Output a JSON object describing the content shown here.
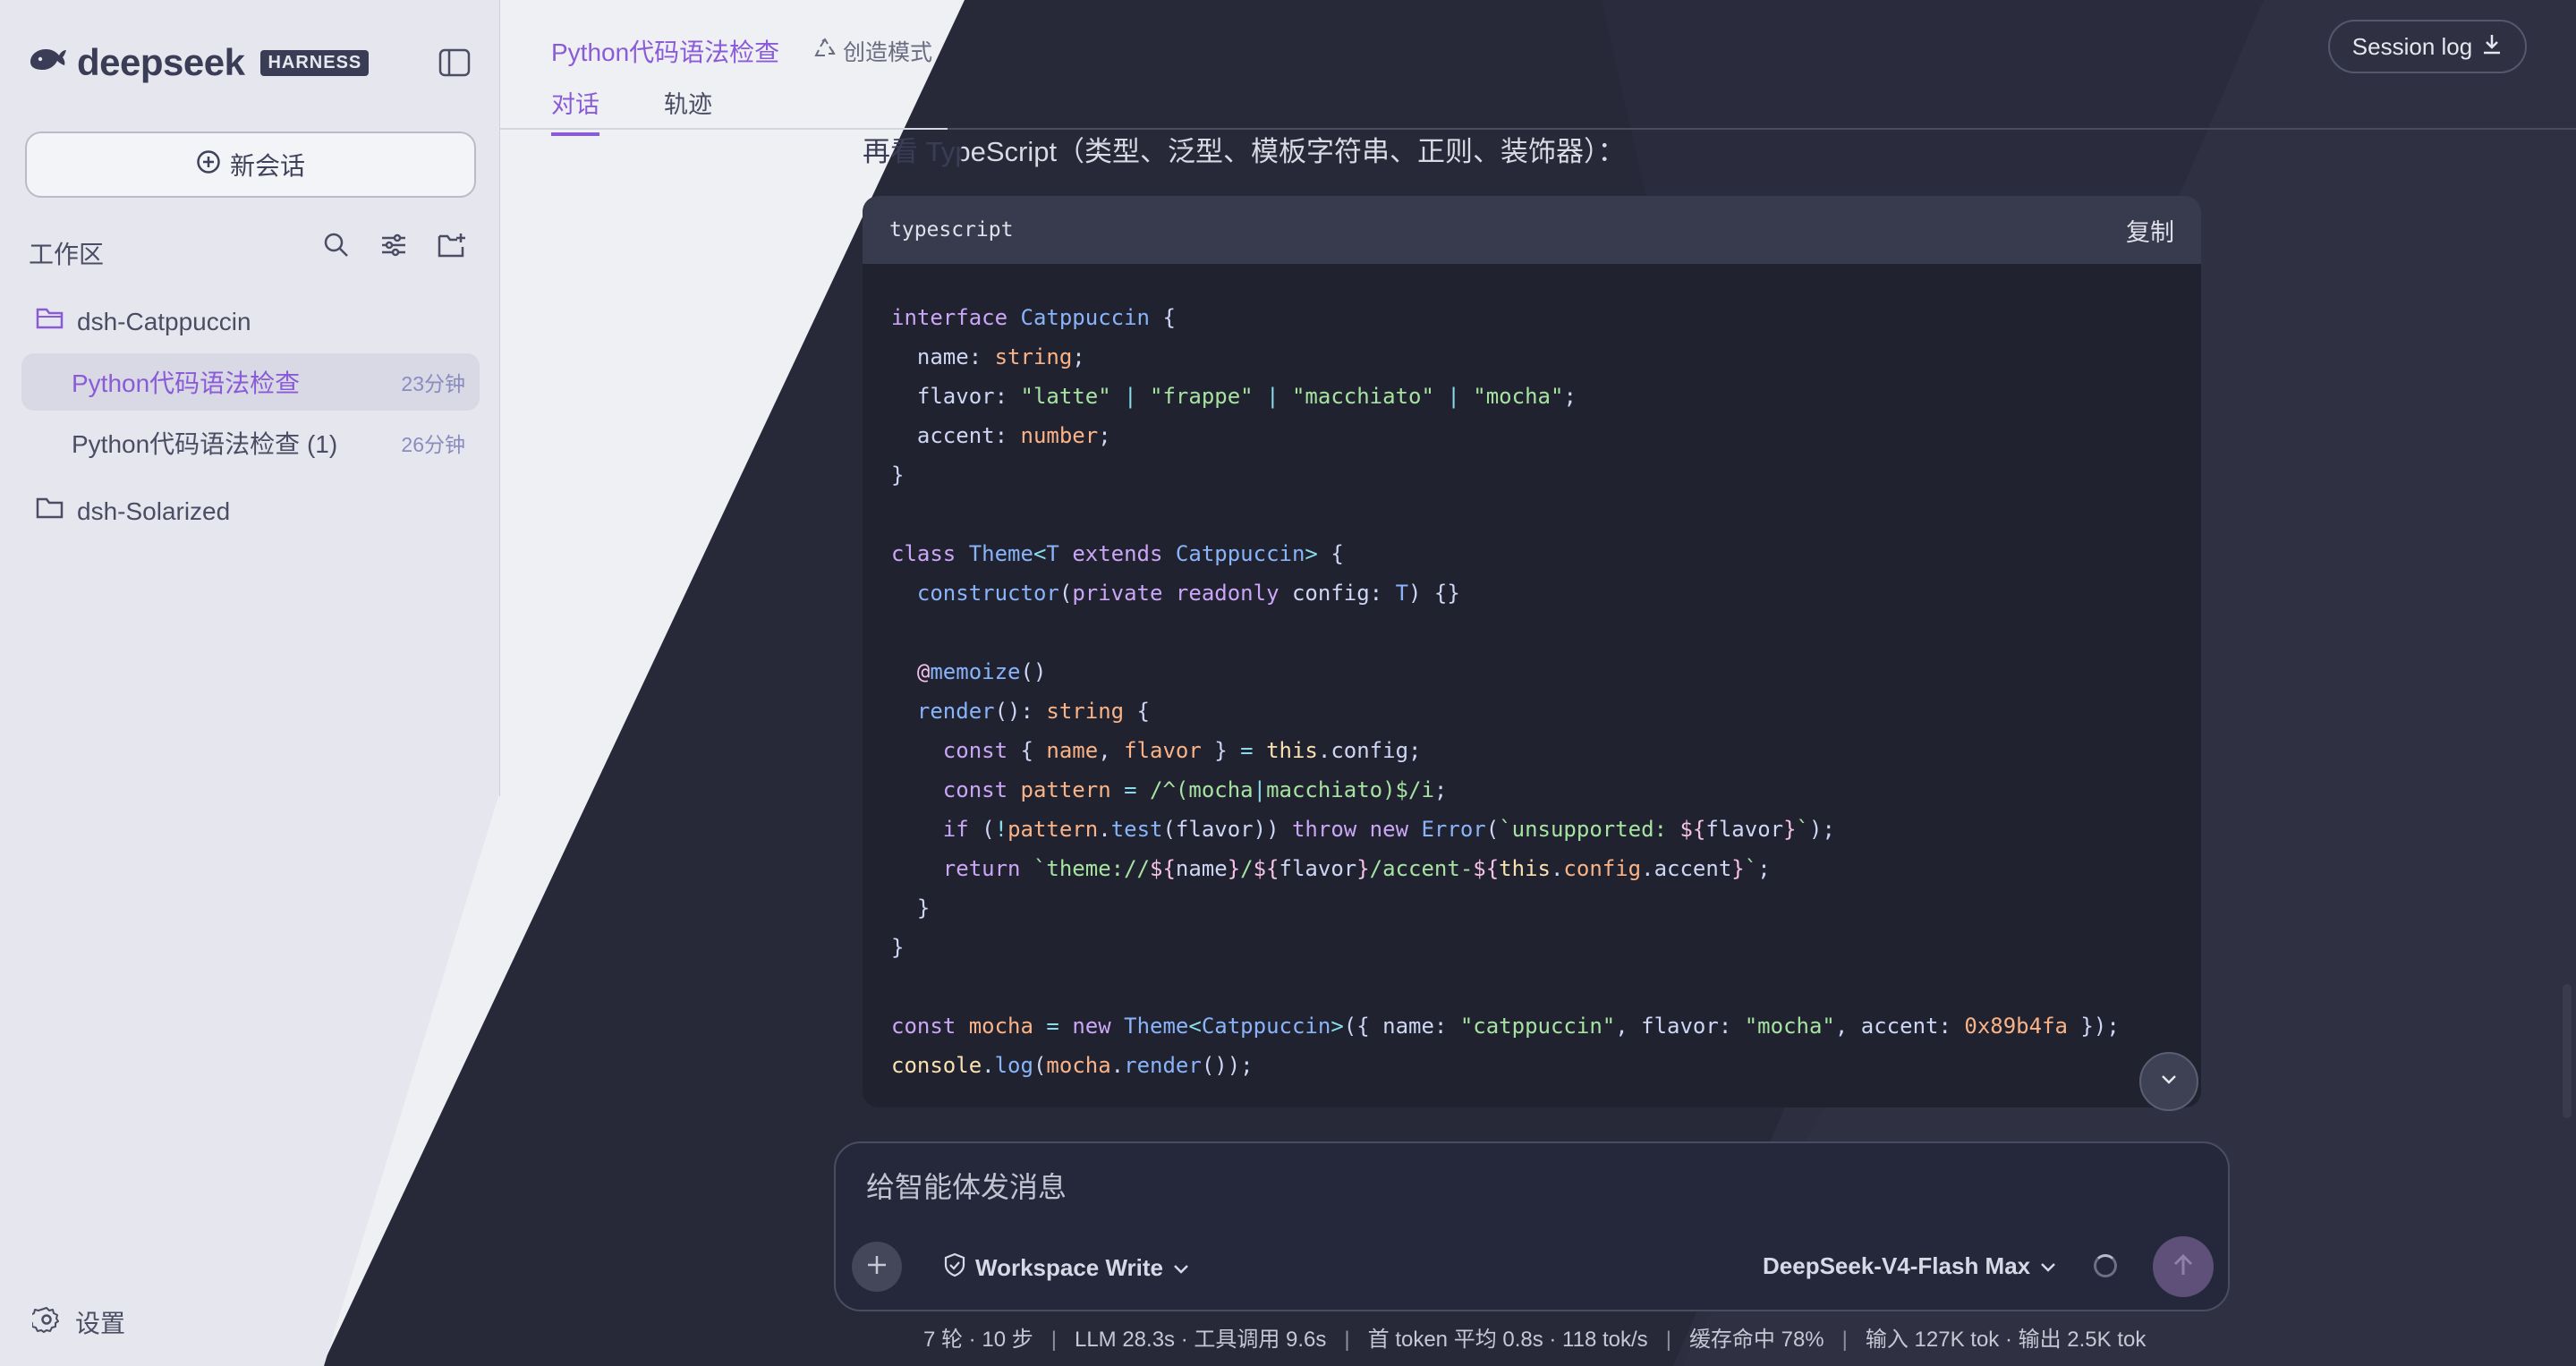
{
  "app": {
    "brand": "deepseek",
    "badge": "HARNESS"
  },
  "sidebar": {
    "new_chat": "新会话",
    "workspace_title": "工作区",
    "folders": [
      {
        "name": "dsh-Catppuccin",
        "open": true
      },
      {
        "name": "dsh-Solarized",
        "open": false
      }
    ],
    "sessions": [
      {
        "title": "Python代码语法检查",
        "ago": "23分钟",
        "active": true
      },
      {
        "title": "Python代码语法检查 (1)",
        "ago": "26分钟",
        "active": false
      }
    ],
    "settings": "设置"
  },
  "header": {
    "title": "Python代码语法检查",
    "mode": "创造模式",
    "tabs": [
      "对话",
      "轨迹"
    ],
    "session_log": "Session log"
  },
  "message": {
    "lead": "再看 TypeScript（类型、泛型、模板字符串、正则、装饰器）：",
    "code_lang": "typescript",
    "copy_label": "复制"
  },
  "composer": {
    "placeholder": "给智能体发消息",
    "permission": "Workspace Write",
    "model": "DeepSeek-V4-Flash Max"
  },
  "stats": {
    "turns": "7 轮 · 10 步",
    "llm": "LLM 28.3s · 工具调用 9.6s",
    "first_token": "首 token 平均 0.8s · 118 tok/s",
    "cache": "缓存命中 78%",
    "io": "输入 127K tok · 输出 2.5K tok"
  },
  "colors": {
    "accent": "#8a5bd6",
    "sidebar_bg": "#e6e7ee",
    "dark_bg": "#272939",
    "code_bg": "#21222f"
  }
}
